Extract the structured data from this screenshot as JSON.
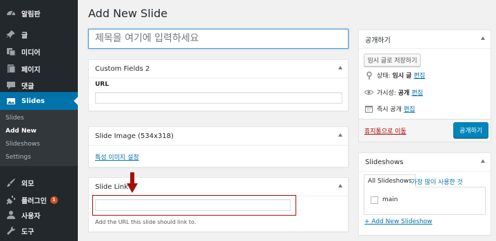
{
  "sidebar": {
    "items": [
      {
        "label": "알림판",
        "icon": "dashboard-icon"
      },
      {
        "label": "글",
        "icon": "pin-icon"
      },
      {
        "label": "미디어",
        "icon": "media-icon"
      },
      {
        "label": "페이지",
        "icon": "page-icon"
      },
      {
        "label": "댓글",
        "icon": "comment-icon"
      },
      {
        "label": "Slides",
        "icon": "slides-icon"
      },
      {
        "label": "외모",
        "icon": "brush-icon"
      },
      {
        "label": "플러그인",
        "icon": "plugin-icon",
        "badge": "1"
      },
      {
        "label": "사용자",
        "icon": "user-icon"
      },
      {
        "label": "도구",
        "icon": "wrench-icon"
      }
    ],
    "submenu": [
      "Slides",
      "Add New",
      "Slideshows",
      "Settings"
    ]
  },
  "page": {
    "title": "Add New Slide",
    "title_placeholder": "제목을 여기에 입력하세요"
  },
  "custom_fields": {
    "header": "Custom Fields 2",
    "url_label": "URL",
    "url_value": ""
  },
  "slide_image": {
    "header": "Slide Image (534x318)",
    "set_link": "특성 이미지 설정"
  },
  "slide_link": {
    "header": "Slide Link",
    "value": "",
    "hint": "Add the URL this slide should link to."
  },
  "publish": {
    "header": "공개하기",
    "save_draft": "임시 글로 저장하기",
    "status_label": "상태:",
    "status_value": "임시 글",
    "visibility_label": "가시성:",
    "visibility_value": "공개",
    "schedule_label": "즉시 공개",
    "edit": "편집",
    "trash": "휴지통으로 이동",
    "publish_button": "공개하기"
  },
  "slideshows": {
    "header": "Slideshows",
    "tab_all": "All Slideshows",
    "tab_popular": "가장 많이 사용한 것",
    "items": [
      {
        "name": "main",
        "checked": false
      }
    ],
    "add_new": "+ Add New Slideshow"
  },
  "colors": {
    "sidebar_bg": "#23282d",
    "accent": "#0073aa",
    "trash": "#a00",
    "highlight_red": "#a50d0d"
  }
}
